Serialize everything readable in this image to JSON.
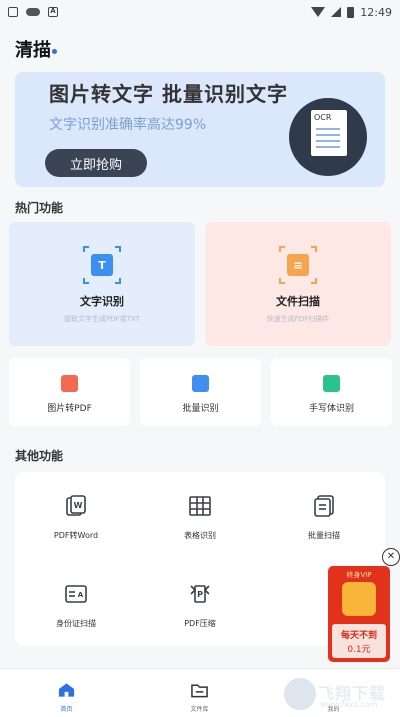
{
  "status_bar": {
    "time": "12:49"
  },
  "app": {
    "title": "清描"
  },
  "banner": {
    "title": "图片转文字 批量识别文字",
    "subtitle": "文字识别准确率高达99%",
    "button": "立即抢购",
    "doc_label": "OCR"
  },
  "hot": {
    "title": "热门功能",
    "big_cards": [
      {
        "label": "文字识别",
        "sub": "提取文字生成PDF或TXT",
        "icon": "text-recognize-icon",
        "color": "#3b8ff3"
      },
      {
        "label": "文件扫描",
        "sub": "快速生成PDF扫描件",
        "icon": "file-scan-icon",
        "color": "#f6a44e"
      }
    ],
    "small_cards": [
      {
        "label": "图片转PDF",
        "icon": "image-to-pdf-icon",
        "color": "#f26a50"
      },
      {
        "label": "批量识别",
        "icon": "batch-recognize-icon",
        "color": "#3f8ef0"
      },
      {
        "label": "手写体识别",
        "icon": "handwriting-icon",
        "color": "#2cc28d"
      }
    ]
  },
  "other": {
    "title": "其他功能",
    "items": [
      {
        "label": "PDF转Word",
        "icon": "pdf-to-word-icon"
      },
      {
        "label": "表格识别",
        "icon": "table-recognize-icon"
      },
      {
        "label": "批量扫描",
        "icon": "batch-scan-icon"
      },
      {
        "label": "身份证扫描",
        "icon": "id-card-scan-icon"
      },
      {
        "label": "PDF压缩",
        "icon": "pdf-compress-icon"
      }
    ]
  },
  "vip_promo": {
    "top": "终身VIP",
    "line1": "每天不到",
    "line2": "0.1元",
    "close": "✕"
  },
  "tabs": [
    {
      "label": "首页",
      "icon": "home-icon"
    },
    {
      "label": "文件库",
      "icon": "folder-icon"
    },
    {
      "label": "我的",
      "icon": "profile-icon"
    }
  ],
  "watermark": {
    "text": "飞翔下载",
    "url": "www.fxxz.com"
  }
}
